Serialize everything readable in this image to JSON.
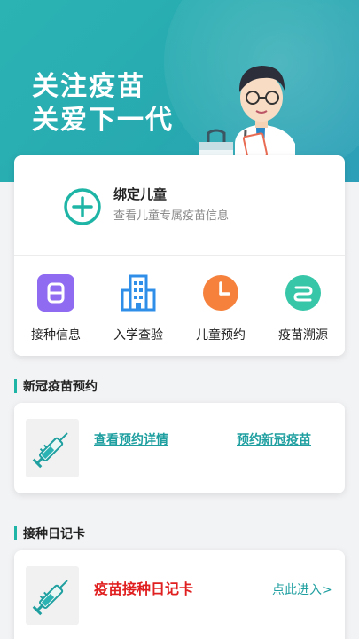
{
  "hero": {
    "title_line1": "关注疫苗",
    "title_line2": "关爱下一代"
  },
  "bind_child": {
    "title": "绑定儿童",
    "subtitle": "查看儿童专属疫苗信息",
    "icon": "plus-circle-icon"
  },
  "features": [
    {
      "label": "接种信息",
      "icon": "vaccination-info-icon",
      "color": "#8f6bf2"
    },
    {
      "label": "入学查验",
      "icon": "school-building-icon",
      "color": "#2f8fe8"
    },
    {
      "label": "儿童预约",
      "icon": "clock-icon",
      "color": "#f5813d"
    },
    {
      "label": "疫苗溯源",
      "icon": "trace-icon",
      "color": "#37c6a8"
    }
  ],
  "covid_section": {
    "title": "新冠疫苗预约",
    "view_details": "查看预约详情",
    "book": "预约新冠疫苗",
    "icon": "syringe-icon"
  },
  "diary_section": {
    "title": "接种日记卡",
    "card_title": "疫苗接种日记卡",
    "enter": "点此进入>",
    "icon": "syringe-icon"
  },
  "colors": {
    "accent": "#1fb5a6",
    "hero": "#2bb3b3",
    "link": "#1f9fa0",
    "alert": "#e02020"
  }
}
